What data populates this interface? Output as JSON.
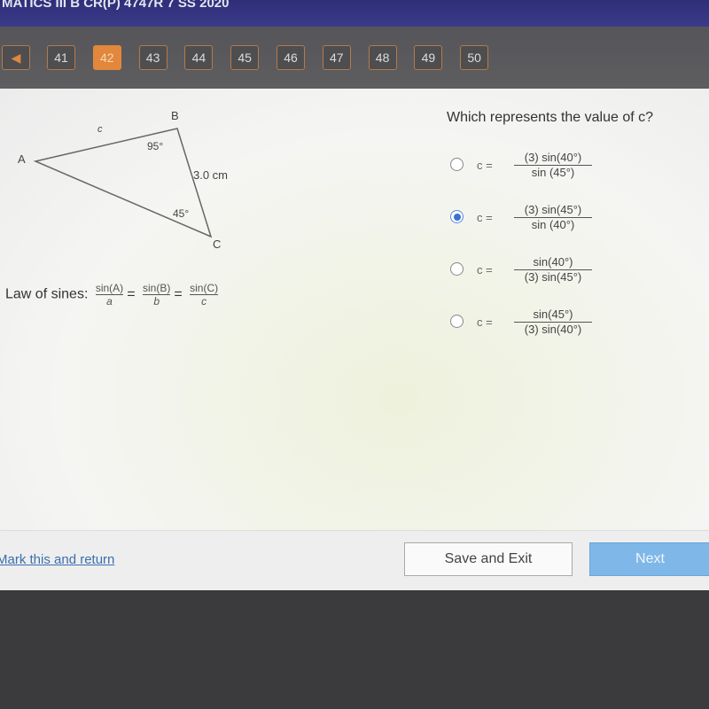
{
  "header": {
    "title": "MATICS III B CR(P) 4747R 7 SS 2020"
  },
  "nav": {
    "prev_icon": "triangle-left-icon",
    "pages": [
      "41",
      "42",
      "43",
      "44",
      "45",
      "46",
      "47",
      "48",
      "49",
      "50"
    ],
    "current": "42"
  },
  "diagram": {
    "vertex_a": "A",
    "vertex_b": "B",
    "vertex_c": "C",
    "side_c": "c",
    "side_bc": "3.0 cm",
    "angle_b": "95°",
    "angle_c": "45°"
  },
  "law": {
    "label": "Law of sines:",
    "f1n": "sin(A)",
    "f1d": "a",
    "f2n": "sin(B)",
    "f2d": "b",
    "f3n": "sin(C)",
    "f3d": "c",
    "eq": "="
  },
  "question": "Which represents the value of c?",
  "options": [
    {
      "lhs": "c =",
      "num": "(3) sin(40°)",
      "den": "sin (45°)",
      "selected": false
    },
    {
      "lhs": "c =",
      "num": "(3) sin(45°)",
      "den": "sin (40°)",
      "selected": true
    },
    {
      "lhs": "c =",
      "num": "sin(40°)",
      "den": "(3) sin(45°)",
      "selected": false
    },
    {
      "lhs": "c =",
      "num": "sin(45°)",
      "den": "(3) sin(40°)",
      "selected": false
    }
  ],
  "footer": {
    "mark": "Mark this and return",
    "save": "Save and Exit",
    "next": "Next"
  },
  "colors": {
    "accent": "#e2873c",
    "next": "#7fb7e8",
    "header": "#2f2e78"
  }
}
